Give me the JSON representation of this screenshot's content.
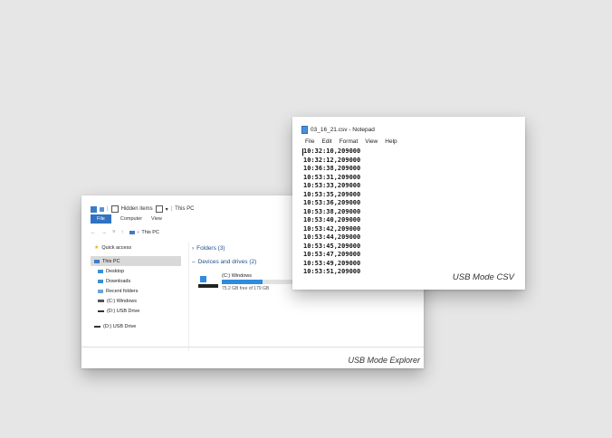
{
  "explorer": {
    "title_checkbox_label": "Hidden items",
    "title_arrow": "▾",
    "title_path": "This PC",
    "ribbon": {
      "file": "File",
      "computer": "Computer",
      "view": "View"
    },
    "nav": {
      "back": "←",
      "forward": "→",
      "dropdown": "˅",
      "up": "↑"
    },
    "address": "This PC",
    "sidebar": [
      {
        "label": "Quick access",
        "icon": "star-icon"
      },
      {
        "label": "This PC",
        "icon": "pc-icon",
        "selected": true
      },
      {
        "label": "Desktop",
        "icon": "folder-icon"
      },
      {
        "label": "Downloads",
        "icon": "folder-icon"
      },
      {
        "label": "Recent folders",
        "icon": "recent-icon"
      },
      {
        "label": "(C:) Windows",
        "icon": "drive-icon"
      },
      {
        "label": "(D:) USB Drive",
        "icon": "usb-drive-icon"
      },
      {
        "label": "(D:) USB Drive",
        "icon": "usb-drive-icon"
      }
    ],
    "sections": {
      "folders": "Folders (3)",
      "devices": "Devices and drives (2)"
    },
    "drive": {
      "label": "(C:) Windows",
      "free": "75.2 GB free of 179 GB",
      "used_fraction": 0.58
    },
    "caption": "USB Mode Explorer"
  },
  "notepad": {
    "title": "03_16_21.csv - Notepad",
    "menu": [
      "File",
      "Edit",
      "Format",
      "View",
      "Help"
    ],
    "lines": [
      "10:32:10,209000",
      "10:32:12,209000",
      "10:36:38,209000",
      "10:53:31,209000",
      "10:53:33,209000",
      "10:53:35,209000",
      "10:53:36,209000",
      "10:53:38,209000",
      "10:53:40,209000",
      "10:53:42,209000",
      "10:53:44,209000",
      "10:53:45,209000",
      "10:53:47,209000",
      "10:53:49,209000",
      "10:53:51,209000"
    ],
    "caption": "USB Mode CSV"
  },
  "colors": {
    "accent": "#2f72c2",
    "drive_bar": "#2f8be0"
  }
}
